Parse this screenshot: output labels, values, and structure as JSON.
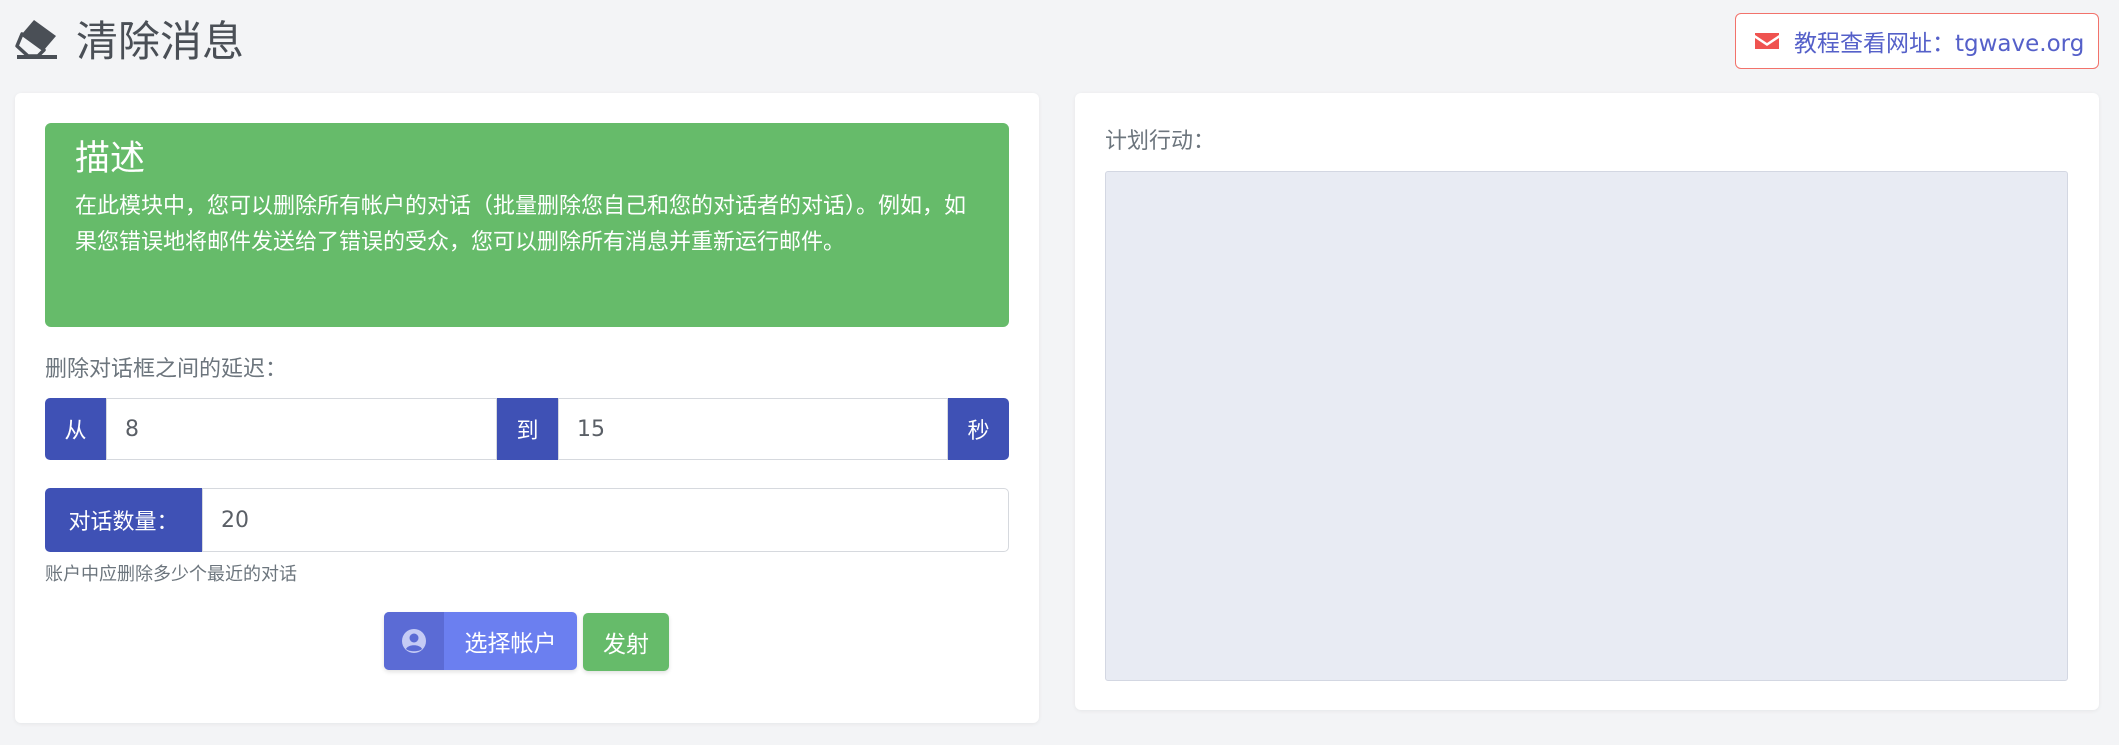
{
  "header": {
    "title": "清除消息",
    "title_icon": "eraser-icon",
    "tutorial_link": {
      "label": "教程查看网址：tgwave.org",
      "icon": "mail-icon",
      "border_color": "#f2726b",
      "text_color": "#5560c9"
    }
  },
  "description": {
    "title": "描述",
    "text": "在此模块中，您可以删除所有帐户的对话（批量删除您自己和您的对话者的对话）。例如，如果您错误地将邮件发送给了错误的受众，您可以删除所有消息并重新运行邮件。",
    "background_color": "#66bb6a"
  },
  "delay": {
    "label": "删除对话框之间的延迟：",
    "from_label": "从",
    "from_value": "8",
    "to_label": "到",
    "to_value": "15",
    "unit_label": "秒"
  },
  "dialog_count": {
    "label": "对话数量：",
    "value": "20",
    "help": "账户中应删除多少个最近的对话"
  },
  "actions": {
    "select_accounts": {
      "label": "选择帐户",
      "icon": "user-circle-icon"
    },
    "launch": {
      "label": "发射"
    }
  },
  "plan": {
    "label": "计划行动："
  },
  "colors": {
    "accent": "#3f51b5",
    "primary_button": "#6b7ff0",
    "success": "#66bb6a",
    "page_background": "#f3f4f6"
  }
}
